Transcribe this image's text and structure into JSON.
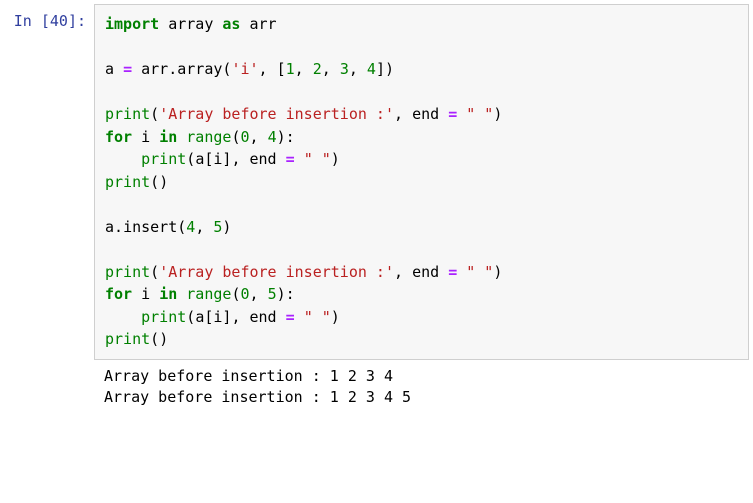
{
  "prompt": {
    "in_label": "In [",
    "number": "40",
    "close": "]:"
  },
  "code": {
    "kw_import": "import",
    "mod_array": "array",
    "kw_as": "as",
    "alias_arr": "arr",
    "var_a": "a",
    "op_eq": "=",
    "name_arr": "arr",
    "dot": ".",
    "call_array": "array",
    "str_i": "'i'",
    "list_open": "[",
    "n1": "1",
    "n2": "2",
    "n3": "3",
    "n4": "4",
    "n5": "5",
    "n0": "0",
    "list_close": "]",
    "print": "print",
    "str_before": "'Array before insertion :'",
    "kwarg_end": "end",
    "str_space": "\" \"",
    "kw_for": "for",
    "var_i": "i",
    "kw_in": "in",
    "range": "range",
    "lparen": "(",
    "rparen": ")",
    "comma": ",",
    "colon": ":",
    "a_sub_i": "a[i]",
    "insert": "insert",
    "indent": "    "
  },
  "output": {
    "line1": "Array before insertion : 1 2 3 4 ",
    "line2": "Array before insertion : 1 2 3 4 5 "
  }
}
